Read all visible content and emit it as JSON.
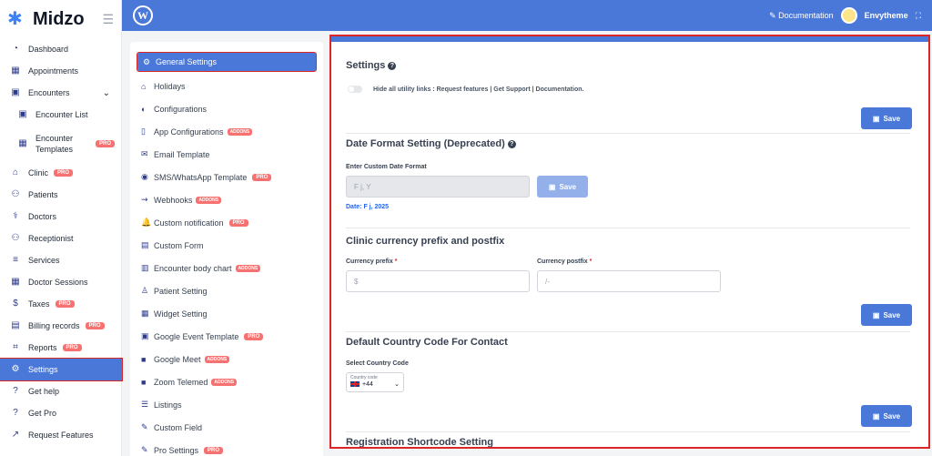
{
  "brand": {
    "name": "Midzo"
  },
  "sidebar": {
    "items": [
      {
        "label": "Dashboard",
        "icon": "dashboard-icon"
      },
      {
        "label": "Appointments",
        "icon": "calendar-icon"
      },
      {
        "label": "Encounters",
        "icon": "calendar-check-icon"
      },
      {
        "label": "Encounter List",
        "icon": "calendar-check-icon"
      },
      {
        "label": "Encounter Templates",
        "icon": "calendar-icon",
        "badge": "PRO"
      },
      {
        "label": "Clinic",
        "icon": "hospital-icon",
        "badge": "PRO"
      },
      {
        "label": "Patients",
        "icon": "users-icon"
      },
      {
        "label": "Doctors",
        "icon": "doctor-icon"
      },
      {
        "label": "Receptionist",
        "icon": "users-icon"
      },
      {
        "label": "Services",
        "icon": "list-icon"
      },
      {
        "label": "Doctor Sessions",
        "icon": "calendar-icon"
      },
      {
        "label": "Taxes",
        "icon": "tax-icon",
        "badge": "PRO"
      },
      {
        "label": "Billing records",
        "icon": "file-icon",
        "badge": "PRO"
      },
      {
        "label": "Reports",
        "icon": "chart-icon",
        "badge": "PRO"
      },
      {
        "label": "Settings",
        "icon": "gears-icon"
      },
      {
        "label": "Get help",
        "icon": "question-icon"
      },
      {
        "label": "Get Pro",
        "icon": "question-icon"
      },
      {
        "label": "Request Features",
        "icon": "external-link-icon"
      }
    ]
  },
  "topbar": {
    "documentation": "Documentation",
    "username": "Envytheme"
  },
  "settings_menu": {
    "items": [
      {
        "label": "General Settings"
      },
      {
        "label": "Holidays"
      },
      {
        "label": "Configurations"
      },
      {
        "label": "App Configurations",
        "badge": "ADDONS"
      },
      {
        "label": "Email Template"
      },
      {
        "label": "SMS/WhatsApp Template",
        "badge": "PRO"
      },
      {
        "label": "Webhooks",
        "badge": "ADDONS"
      },
      {
        "label": "Custom notification",
        "badge": "PRO"
      },
      {
        "label": "Custom Form"
      },
      {
        "label": "Encounter body chart",
        "badge": "ADDONS"
      },
      {
        "label": "Patient Setting"
      },
      {
        "label": "Widget Setting"
      },
      {
        "label": "Google Event Template",
        "badge": "PRO"
      },
      {
        "label": "Google Meet",
        "badge": "ADDONS"
      },
      {
        "label": "Zoom Telemed",
        "badge": "ADDONS"
      },
      {
        "label": "Listings"
      },
      {
        "label": "Custom Field"
      },
      {
        "label": "Pro Settings",
        "badge": "PRO"
      }
    ]
  },
  "main": {
    "settings_title": "Settings",
    "toggle_label": "Hide all utility links : Request features | Get Support | Documentation.",
    "save_label": "Save",
    "date_format": {
      "title": "Date Format Setting (Deprecated)",
      "field_label": "Enter Custom Date Format",
      "value": "F j, Y",
      "hint": "Date: F j, 2025"
    },
    "currency": {
      "title": "Clinic currency prefix and postfix",
      "prefix_label": "Currency prefix",
      "postfix_label": "Currency postfix",
      "prefix_value": "$",
      "postfix_value": "/-"
    },
    "country": {
      "title": "Default Country Code For Contact",
      "label": "Select Country Code",
      "select_caption": "Country code",
      "select_value": "+44"
    },
    "registration": {
      "title": "Registration Shortcode Setting"
    }
  }
}
